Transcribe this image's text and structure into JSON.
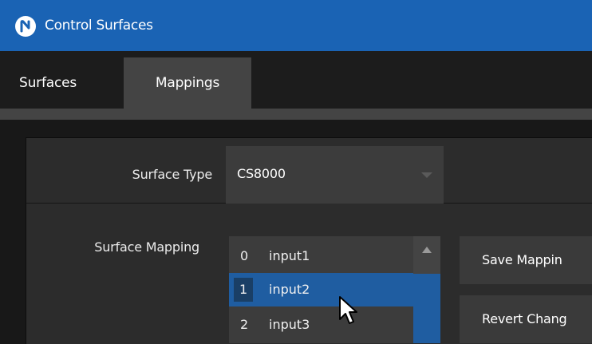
{
  "window": {
    "title": "Control Surfaces"
  },
  "tabs": [
    {
      "label": "Surfaces",
      "active": false
    },
    {
      "label": "Mappings",
      "active": true
    }
  ],
  "surface_type": {
    "label": "Surface Type",
    "value": "CS8000"
  },
  "surface_mapping": {
    "label": "Surface Mapping",
    "items": [
      {
        "index": "0",
        "name": "input1",
        "selected": false
      },
      {
        "index": "1",
        "name": "input2",
        "selected": true
      },
      {
        "index": "2",
        "name": "input3",
        "selected": false
      }
    ]
  },
  "buttons": {
    "save": "Save Mappin",
    "revert": "Revert Chang"
  },
  "colors": {
    "titlebar": "#1a63b4",
    "selection": "#1f5da1",
    "panel": "#2c2c2c"
  },
  "icons": {
    "logo": "newtek-logo-icon",
    "dropdown": "triangle-down-icon",
    "scroll_up": "triangle-up-icon",
    "cursor": "mouse-pointer-icon"
  }
}
